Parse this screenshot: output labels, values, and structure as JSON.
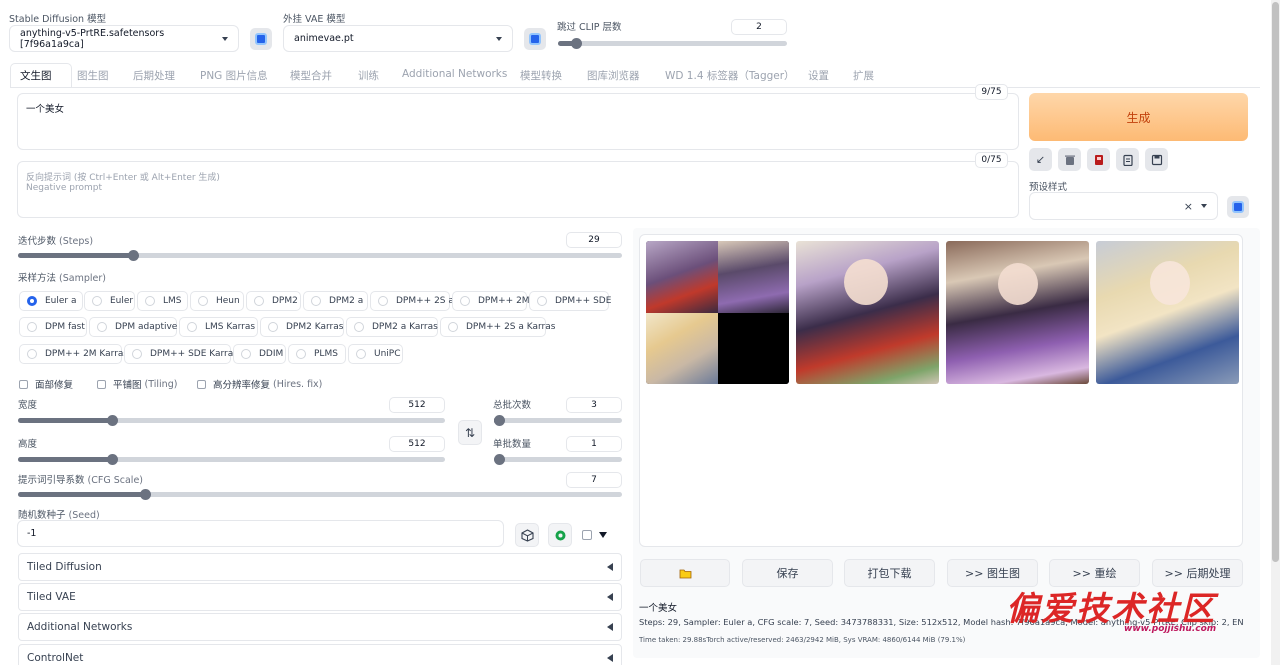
{
  "header": {
    "sd_model": {
      "label": "Stable Diffusion 模型",
      "value": "anything-v5-PrtRE.safetensors [7f96a1a9ca]"
    },
    "vae": {
      "label": "外挂 VAE 模型",
      "value": "animevae.pt"
    },
    "clip_skip": {
      "label": "跳过 CLIP 层数",
      "value": "2",
      "level": 0.08
    }
  },
  "tabs": [
    "文生图",
    "图生图",
    "后期处理",
    "PNG 图片信息",
    "模型合并",
    "训练",
    "Additional Networks",
    "模型转换",
    "图库浏览器",
    "WD 1.4 标签器（Tagger）",
    "设置",
    "扩展"
  ],
  "prompt": {
    "text": "一个美女",
    "counter": "9/75"
  },
  "negative_prompt": {
    "placeholder_cn": "反向提示词 (按 Ctrl+Enter 或 Alt+Enter 生成)",
    "placeholder_en": "Negative prompt",
    "counter": "0/75"
  },
  "generate_label": "生成",
  "toolbar_icons": [
    "check-icon",
    "trash-icon",
    "style-icon",
    "clipboard-icon",
    "save-icon"
  ],
  "styles": {
    "label": "预设样式",
    "clear": "×"
  },
  "steps": {
    "label_cn": "迭代步数",
    "label_en": "(Steps)",
    "value": "29",
    "level": 0.19
  },
  "sampler": {
    "label_cn": "采样方法",
    "label_en": "(Sampler)",
    "row1": [
      "Euler a",
      "Euler",
      "LMS",
      "Heun",
      "DPM2",
      "DPM2 a",
      "DPM++ 2S a",
      "DPM++ 2M",
      "DPM++ SDE"
    ],
    "row2": [
      "DPM fast",
      "DPM adaptive",
      "LMS Karras",
      "DPM2 Karras",
      "DPM2 a Karras",
      "DPM++ 2S a Karras"
    ],
    "row3": [
      "DPM++ 2M Karras",
      "DPM++ SDE Karras",
      "DDIM",
      "PLMS",
      "UniPC"
    ],
    "selected": "Euler a"
  },
  "checks": [
    {
      "cn": "面部修复",
      "en": ""
    },
    {
      "cn": "平铺图",
      "en": "(Tiling)"
    },
    {
      "cn": "高分辨率修复",
      "en": "(Hires. fix)"
    }
  ],
  "width": {
    "label": "宽度",
    "value": "512",
    "level": 0.22
  },
  "height": {
    "label": "高度",
    "value": "512",
    "level": 0.22
  },
  "batch_count": {
    "label": "总批次数",
    "value": "3",
    "level": 0.02
  },
  "batch_size": {
    "label": "单批数量",
    "value": "1",
    "level": 0.0
  },
  "swap_icon": "⇅",
  "cfg": {
    "label_cn": "提示词引导系数",
    "label_en": "(CFG Scale)",
    "value": "7",
    "level": 0.21
  },
  "seed": {
    "label_cn": "随机数种子",
    "label_en": "(Seed)",
    "value": "-1"
  },
  "accordions": [
    "Tiled Diffusion",
    "Tiled VAE",
    "Additional Networks",
    "ControlNet"
  ],
  "actions": [
    "📂",
    "保存",
    "打包下载",
    ">> 图生图",
    ">> 重绘",
    ">> 后期处理"
  ],
  "info": {
    "prompt": "一个美女",
    "params": "Steps: 29, Sampler: Euler a, CFG scale: 7, Seed: 3473788331, Size: 512x512, Model hash: 7f96a1a9ca, Model: anything-v5-PrtRE, Clip skip: 2, ENSD: 31337",
    "time": "Time taken: 29.88sTorch active/reserved: 2463/2942 MiB, Sys VRAM: 4860/6144 MiB (79.1%)"
  },
  "watermark": {
    "title": "偏爱技术社区",
    "url": "www.pojjishu.com"
  }
}
